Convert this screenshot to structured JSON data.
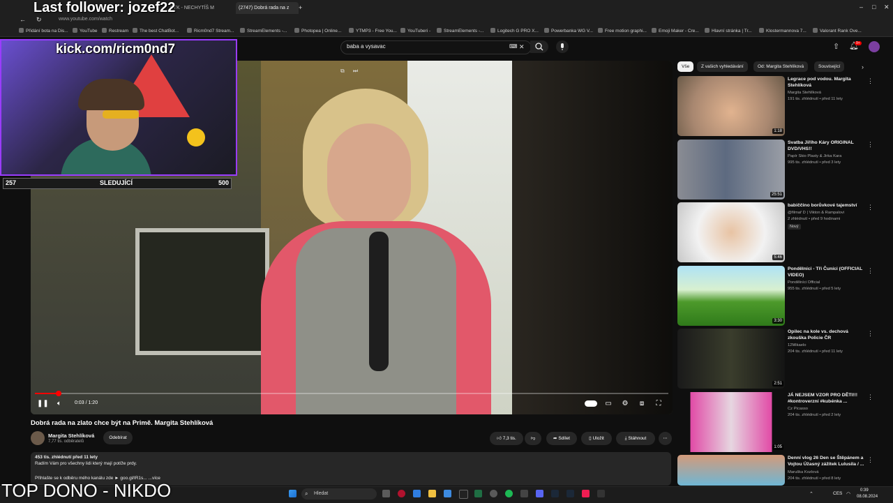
{
  "browser": {
    "tabs": [
      {
        "label": "PTK - NECHYTÍŠ M"
      },
      {
        "label": "(2747) Dobrá rada na z"
      }
    ],
    "url": "www.youtube.com/watch",
    "bookmarks": [
      "Přidání bota na Dis...",
      "YouTube",
      "Restream",
      "The best ChatBot...",
      "Ricm0nd7 Stream...",
      "StreamElements -...",
      "Photopea | Online...",
      "YTMP3 - Free You...",
      "YouTuberi -",
      "StreamElements -...",
      "Logitech G PRO X...",
      "Powerbanka WG V...",
      "Free motion graphi...",
      "Emoji Maker - Cre...",
      "Hlavní stránka | Tr...",
      "Klostermannova 7...",
      "Valorant Rank Ove..."
    ]
  },
  "youtube": {
    "search_query": "baba a vysavac",
    "notification_count": "9+",
    "chips": [
      "Vše",
      "Z vašich vyhledávání",
      "Od: Margita Stehlíková",
      "Související"
    ],
    "player": {
      "time": "0:03 / 1:20",
      "progress": 0.0375
    },
    "video_title": "Dobrá rada na zlato chce být na Primě. Margita Stehlíková",
    "channel": {
      "name": "Margita Stehlíková",
      "subscribers": "7,77 tis. odběratelů",
      "subscribe_label": "Odebírat"
    },
    "actions": {
      "likes": "7,3 tis.",
      "share": "Sdílet",
      "save": "Uložit",
      "download": "Stáhnout"
    },
    "description": {
      "stats": "453 tis. zhlédnutí  před 11 lety",
      "line1": "Radím   Vám   pro  všechny   lidi   který  mají   potíže  prdy.",
      "line2": "Přihlašte se k odběru mého kanálu zde ► goo.gl/IR1s...   ...více"
    },
    "recommendations": [
      {
        "title": "Legrace  pod  vodou. Margita Stehlíková",
        "channel": "Margita Stehlíková",
        "meta": "191 tis. zhlédnutí • před 11 lety",
        "duration": "1:18",
        "badge": ""
      },
      {
        "title": "Svatba Jiřího Káry ORIGINAL DVD/VHS!!",
        "channel": "Papír Skio Plasty & Jirka Kara",
        "meta": "995 tis. zhlédnutí • před 3 lety",
        "duration": "25:51",
        "badge": ""
      },
      {
        "title": "babiččino borůvkové tajemství",
        "channel": "@filmař D | Vikton & Rampalovi",
        "meta": "2 zhlédnutí • před 9 hodinami",
        "duration": "5:46",
        "badge": "Nový"
      },
      {
        "title": "Pondělníci - Tři Čuníci (OFFICIAL VIDEO)",
        "channel": "Pondělníci Official",
        "meta": "955 tis. zhlédnutí • před 5 lety",
        "duration": "3:30",
        "badge": ""
      },
      {
        "title": "Opilec na kole vs. dechová zkouška Policie ČR",
        "channel": "12Mikaelo",
        "meta": "204 tis. zhlédnutí • před 11 lety",
        "duration": "2:51",
        "badge": ""
      },
      {
        "title": "JÁ NEJSEM VZOR PRO DĚTI!!! #kontroverzní #kubénka ...",
        "channel": "Cz Picasso",
        "meta": "204 tis. zhlédnutí • před 2 lety",
        "duration": "1:05",
        "badge": ""
      },
      {
        "title": "Denní vlog 26  Den se Štěpánem a Vojtou  Úžasný zážitek Lulusila / ...",
        "channel": "Maruška Kozlová",
        "meta": "204 tis. zhlédnutí • před 8 lety",
        "duration": "",
        "badge": ""
      }
    ]
  },
  "overlay": {
    "last_follower": "Last follower: jozef22",
    "kick": "kick.com/ricm0nd7",
    "follow_current": "257",
    "follow_label": "SLEDUJÍCÍ",
    "follow_goal": "500",
    "top_dono": "TOP DONO - NIKDO"
  },
  "taskbar": {
    "search_placeholder": "Hledat",
    "language": "CES",
    "time": "0:39",
    "date": "08.08.2024"
  }
}
